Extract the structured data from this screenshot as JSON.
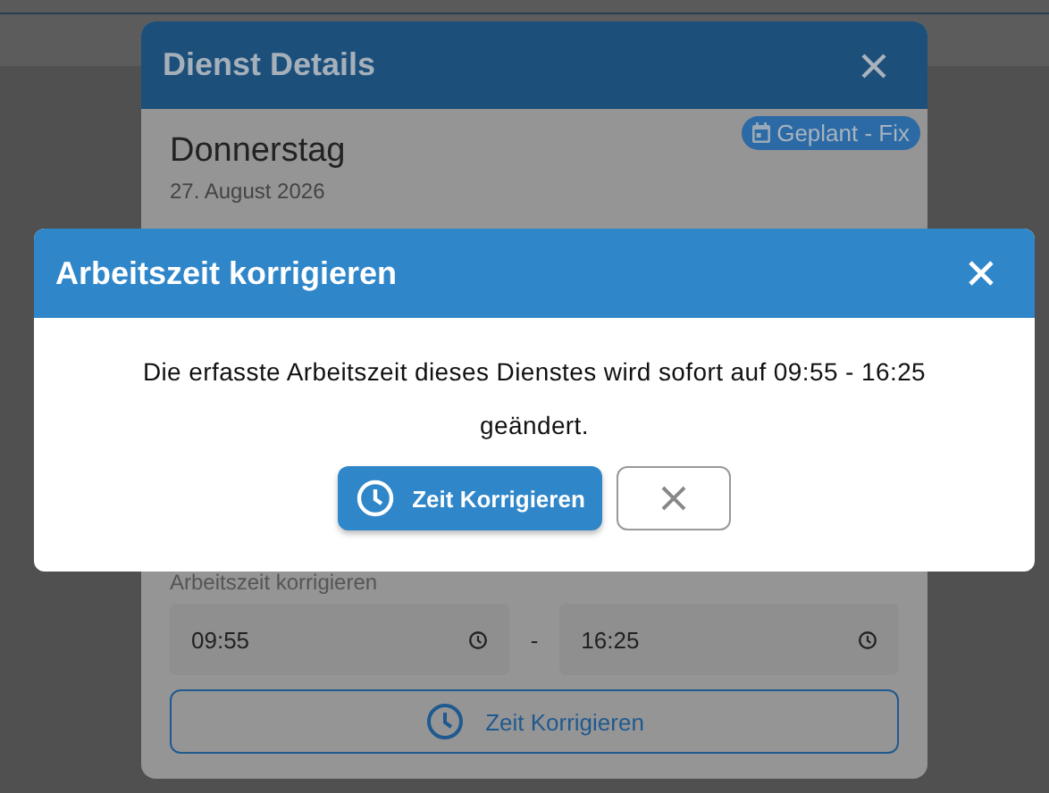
{
  "background_dialog": {
    "title": "Dienst Details",
    "day": "Donnerstag",
    "date": "27. August 2026",
    "badge": "Geplant - Fix",
    "time_label": "Arbeitszeit korrigieren",
    "start_time": "09:55",
    "separator": "-",
    "end_time": "16:25",
    "button": "Zeit Korrigieren"
  },
  "dialog": {
    "title": "Arbeitszeit korrigieren",
    "message": "Die erfasste Arbeitszeit dieses Dienstes wird sofort auf 09:55 - 16:25 geändert.",
    "confirm_button": "Zeit Korrigieren"
  }
}
